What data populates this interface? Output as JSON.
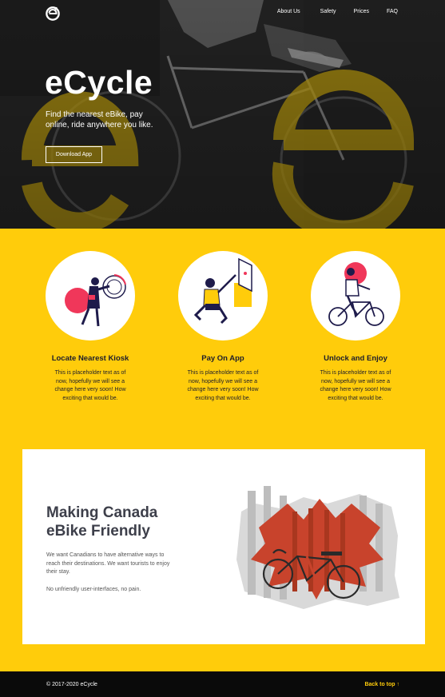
{
  "colors": {
    "accent": "#ffcc0b",
    "dark": "#0a0a0a",
    "heading": "#3d3f4a",
    "pink": "#f0375a",
    "navy": "#1e1b4b",
    "red": "#c8432c"
  },
  "header": {
    "logo_icon": "ecycle-logo-icon",
    "nav": [
      "About Us",
      "Safety",
      "Prices",
      "FAQ"
    ]
  },
  "hero": {
    "title": "eCycle",
    "tagline": "Find the nearest eBike, pay online, ride anywhere you like.",
    "cta_label": "Download App"
  },
  "features": [
    {
      "icon": "kiosk-illustration",
      "title": "Locate Nearest Kiosk",
      "text": "This is placeholder text as of now, hopefully we will see a change here very soon! How exciting that would be."
    },
    {
      "icon": "payment-illustration",
      "title": "Pay On App",
      "text": "This is placeholder text as of now, hopefully we will see a change here very soon! How exciting that would be."
    },
    {
      "icon": "cyclist-illustration",
      "title": "Unlock and Enjoy",
      "text": "This is placeholder text as of now, hopefully we will see a change here very soon! How exciting that would be."
    }
  ],
  "about": {
    "heading_line1": "Making Canada",
    "heading_line2": "eBike Friendly",
    "paragraph1": "We want Canadians to have alternative ways to reach their destinations. We want tourists to enjoy their stay.",
    "paragraph2": "No unfriendly user-interfaces, no pain.",
    "image": "canada-flag-bike-image"
  },
  "footer": {
    "copyright": "© 2017-2020 eCycle",
    "back_to_top": "Back to top ↑"
  }
}
